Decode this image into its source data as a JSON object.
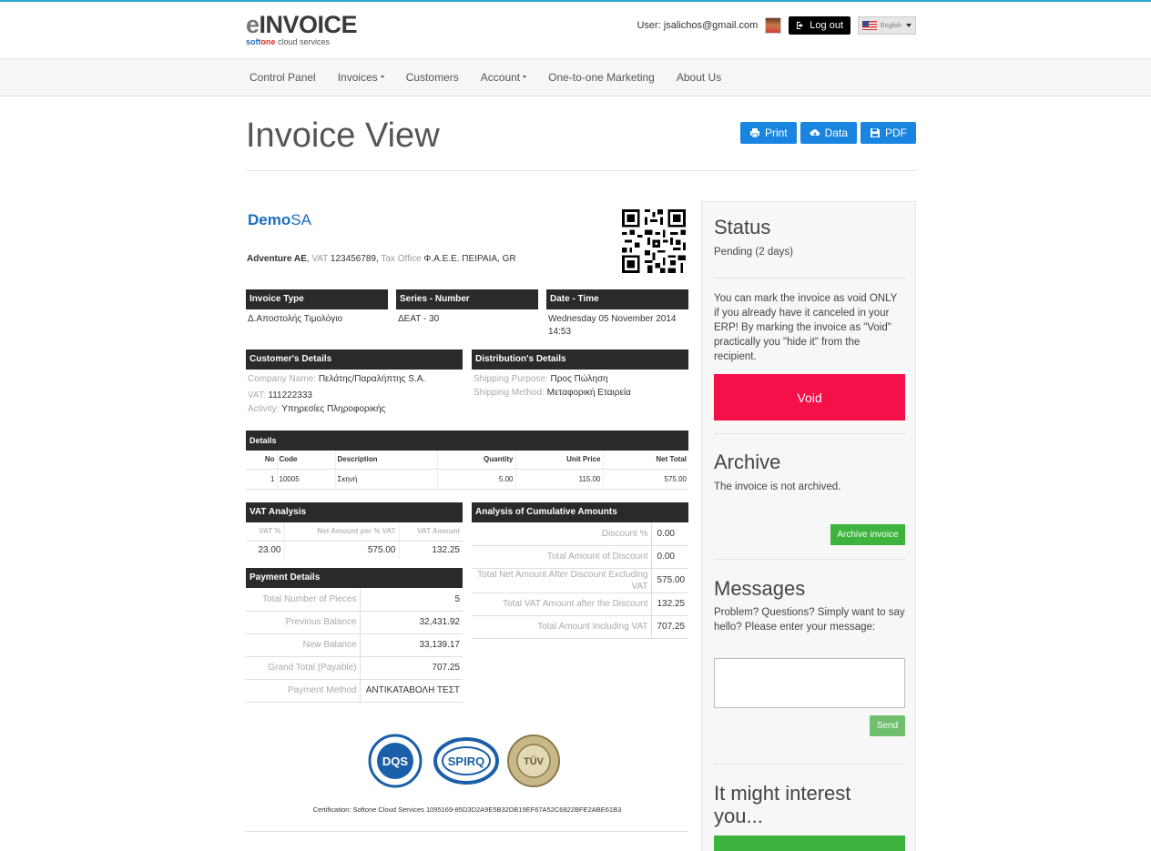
{
  "brand": {
    "logo_e": "e",
    "logo_main": "INVOICE",
    "logo_soft": "soft",
    "logo_one": "one",
    "logo_sub": " cloud services"
  },
  "user": {
    "label": "User: jsalichos@gmail.com",
    "logout": "Log out",
    "language": "English"
  },
  "nav": [
    {
      "label": "Control Panel",
      "dropdown": false
    },
    {
      "label": "Invoices",
      "dropdown": true
    },
    {
      "label": "Customers",
      "dropdown": false
    },
    {
      "label": "Account",
      "dropdown": true
    },
    {
      "label": "One-to-one Marketing",
      "dropdown": false
    },
    {
      "label": "About Us",
      "dropdown": false
    }
  ],
  "page": {
    "title": "Invoice View"
  },
  "actions": {
    "print": "Print",
    "data": "Data",
    "pdf": "PDF"
  },
  "issuer": {
    "logo_demo": "Demo",
    "logo_sa": "SA",
    "name": "Adventure AE",
    "vat_label": "VAT",
    "vat": "123456789",
    "tax_office_label": "Tax Office",
    "tax_office": "Φ.Α.Ε.Ε. ΠΕΙΡΑΙΑ, GR"
  },
  "invoice_type": {
    "header": "Invoice Type",
    "value": "Δ.Αποστολής Τιμολόγιο"
  },
  "series": {
    "header": "Series - Number",
    "value": "ΔΕΑΤ - 30"
  },
  "datetime": {
    "header": "Date - Time",
    "value": "Wednesday 05 November 2014 14:53"
  },
  "customer": {
    "header": "Customer's Details",
    "company_label": "Company Name:",
    "company": "Πελάτης/Παραλήπτης S.A.",
    "vat_label": "VAT:",
    "vat": "111222333",
    "activity_label": "Activity:",
    "activity": "Υπηρεσίες Πληροφορικής"
  },
  "distribution": {
    "header": "Distribution's Details",
    "purpose_label": "Shipping Purpose:",
    "purpose": "Προς Πώληση",
    "method_label": "Shipping Method:",
    "method": "Μεταφορική Εταιρεία"
  },
  "details": {
    "header": "Details",
    "columns": {
      "no": "No",
      "code": "Code",
      "description": "Description",
      "quantity": "Quantity",
      "unit_price": "Unit Price",
      "net_total": "Net Total"
    },
    "rows": [
      {
        "no": "1",
        "code": "10005",
        "description": "Σκηνή",
        "quantity": "5.00",
        "unit_price": "115.00",
        "net_total": "575.00"
      }
    ]
  },
  "vat_analysis": {
    "header": "VAT Analysis",
    "columns": {
      "vat_pct": "VAT %",
      "net": "Net Amount per % VAT",
      "amount": "VAT Amount"
    },
    "rows": [
      {
        "vat_pct": "23.00",
        "net": "575.00",
        "amount": "132.25"
      }
    ]
  },
  "payment": {
    "header": "Payment Details",
    "rows": [
      {
        "label": "Total Number of Pieces",
        "value": "5"
      },
      {
        "label": "Previous Balance",
        "value": "32,431.92"
      },
      {
        "label": "New Balance",
        "value": "33,139.17"
      },
      {
        "label": "Grand Total (Payable)",
        "value": "707.25"
      },
      {
        "label": "Payment Method",
        "value": "ΑΝΤΙΚΑΤΑΒΟΛΗ ΤΕΣΤ"
      }
    ]
  },
  "cumulative": {
    "header": "Analysis of Cumulative Amounts",
    "rows": [
      {
        "label": "Discount %",
        "value": "0.00"
      },
      {
        "label": "Total Amount of Discount",
        "value": "0.00"
      },
      {
        "label": "Total Net Amount After Discount Excluding VAT",
        "value": "575.00"
      },
      {
        "label": "Total VAT Amount after the Discount",
        "value": "132.25"
      },
      {
        "label": "Total Amount Including VAT",
        "value": "707.25"
      }
    ]
  },
  "seals": {
    "dqs": "DQS",
    "spirq": "SPIRQ",
    "tuv": "TÜV"
  },
  "certification": "Certification: Softone Cloud Services 1095169-85D3D2A9E5B32DB19EF67A52C6822BFE2ABE61B3",
  "sidebar": {
    "status_title": "Status",
    "status_value": "Pending (2 days)",
    "void_text": "You can mark the invoice as void ONLY if you already have it canceled in your ERP! By marking the invoice as \"Void\" practically you \"hide it\" from the recipient.",
    "void_button": "Void",
    "archive_title": "Archive",
    "archive_text": "The invoice is not archived.",
    "archive_button": "Archive invoice",
    "messages_title": "Messages",
    "messages_text": "Problem? Questions? Simply want to say hello? Please enter your message:",
    "send_button": "Send",
    "interest_line1": "It might interest",
    "interest_line2": "you..."
  },
  "colors": {
    "accent_blue": "#1a85e0",
    "void_red": "#f5104a",
    "green": "#3db43d",
    "section_dark": "#2a2a2a"
  }
}
